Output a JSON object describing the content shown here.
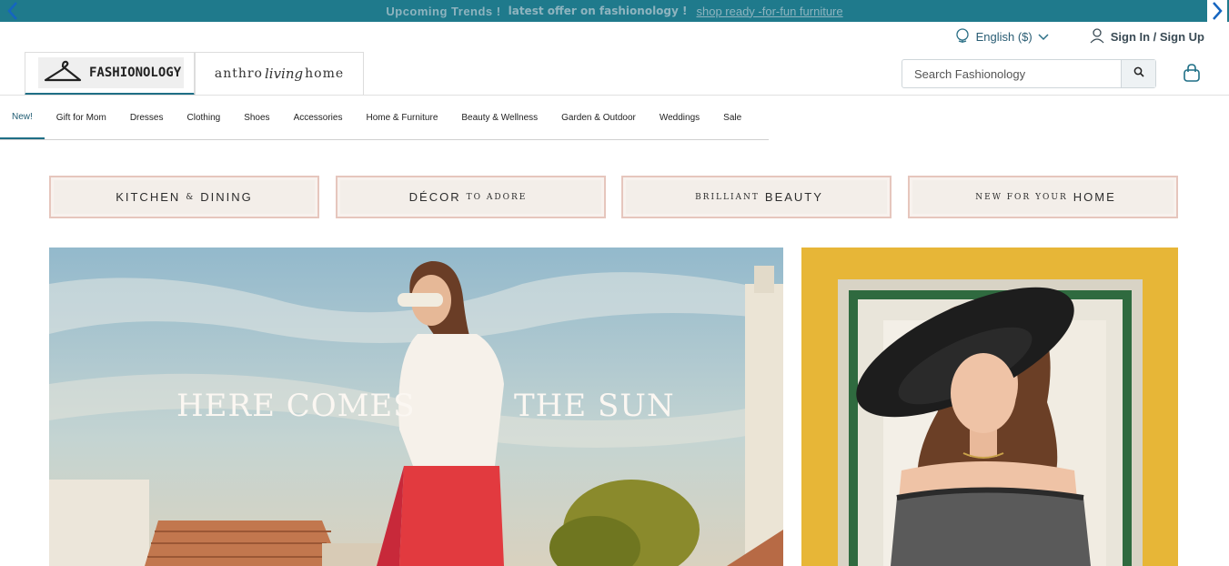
{
  "promo": {
    "text_1": "Upcoming Trends !",
    "text_2": "latest offer on fashionology !",
    "link": "shop ready -for-fun furniture"
  },
  "utility": {
    "language": "English ($)",
    "account": "Sign In / Sign Up"
  },
  "logos": {
    "primary": "FASHIONOLOGY",
    "secondary_a": "anthro",
    "secondary_script": "living",
    "secondary_b": "home"
  },
  "search": {
    "placeholder": "Search Fashionology"
  },
  "nav": {
    "items": [
      {
        "label": "New!"
      },
      {
        "label": "Gift for Mom"
      },
      {
        "label": "Dresses"
      },
      {
        "label": "Clothing"
      },
      {
        "label": "Shoes"
      },
      {
        "label": "Accessories"
      },
      {
        "label": "Home & Furniture"
      },
      {
        "label": "Beauty & Wellness"
      },
      {
        "label": "Garden & Outdoor"
      },
      {
        "label": "Weddings"
      },
      {
        "label": "Sale"
      }
    ]
  },
  "categories": [
    {
      "a": "KITCHEN",
      "b": "&",
      "c": "DINING"
    },
    {
      "a": "DÉCOR",
      "b": "TO ADORE",
      "c": ""
    },
    {
      "a": "",
      "b": "BRILLIANT",
      "c": "BEAUTY"
    },
    {
      "a": "",
      "b": "NEW FOR YOUR",
      "c": "HOME"
    }
  ],
  "hero": {
    "left_text": "HERE COMES",
    "right_text": "THE SUN"
  },
  "colors": {
    "brand_teal": "#1f7a8c",
    "accent_blue": "#1565c0"
  }
}
